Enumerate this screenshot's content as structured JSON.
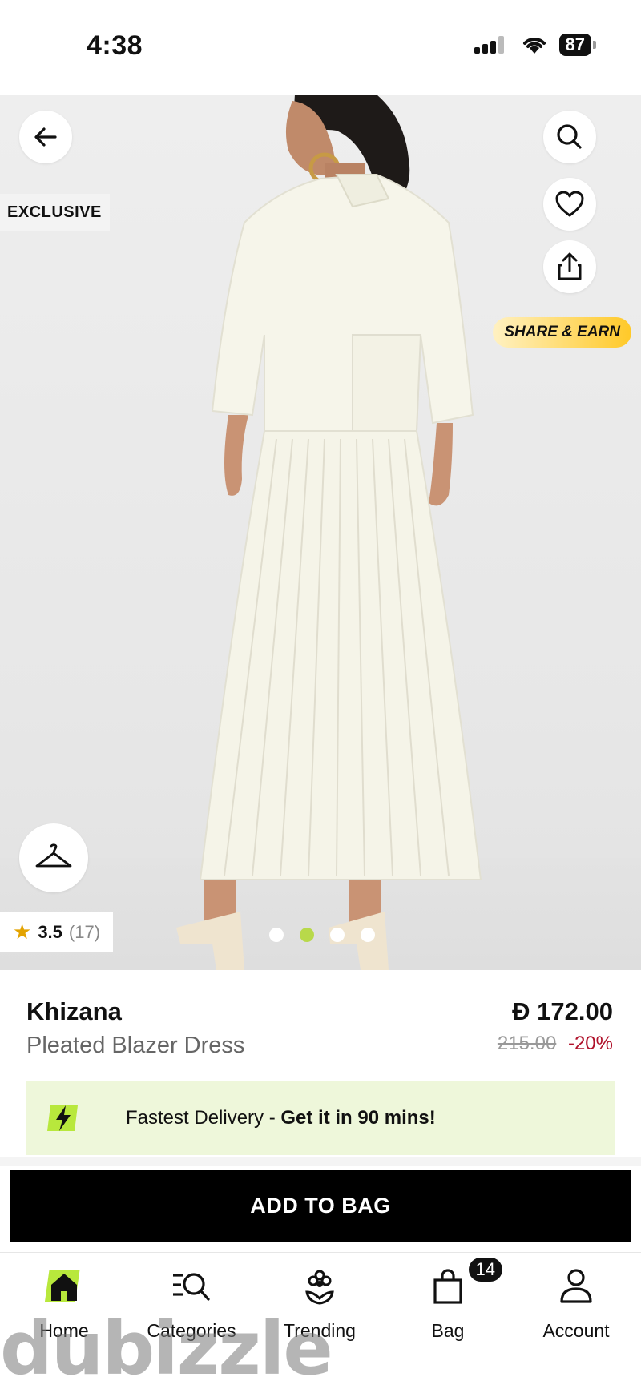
{
  "status": {
    "time": "4:38",
    "battery": "87"
  },
  "hero": {
    "badge_exclusive": "EXCLUSIVE",
    "share_earn": "SHARE & EARN",
    "rating": {
      "value": "3.5",
      "count": "(17)"
    },
    "carousel": {
      "total": 4,
      "active_index": 2
    }
  },
  "product": {
    "brand": "Khizana",
    "name": "Pleated Blazer Dress",
    "price": "172.00",
    "currency_symbol": "Đ",
    "old_price": "215.00",
    "discount": "-20%"
  },
  "delivery": {
    "prefix": "Fastest Delivery - ",
    "highlight": "Get it in 90 mins!"
  },
  "cta": {
    "add_to_bag": "ADD TO BAG"
  },
  "nav": {
    "items": [
      {
        "label": "Home",
        "icon": "home-icon"
      },
      {
        "label": "Categories",
        "icon": "categories-icon"
      },
      {
        "label": "Trending",
        "icon": "trending-icon"
      },
      {
        "label": "Bag",
        "icon": "bag-icon",
        "badge": "14"
      },
      {
        "label": "Account",
        "icon": "account-icon"
      }
    ]
  },
  "watermark": "dubizzle",
  "colors": {
    "accent_green": "#b8d94a",
    "discount_red": "#b0122b",
    "delivery_bg": "#eef7da"
  }
}
